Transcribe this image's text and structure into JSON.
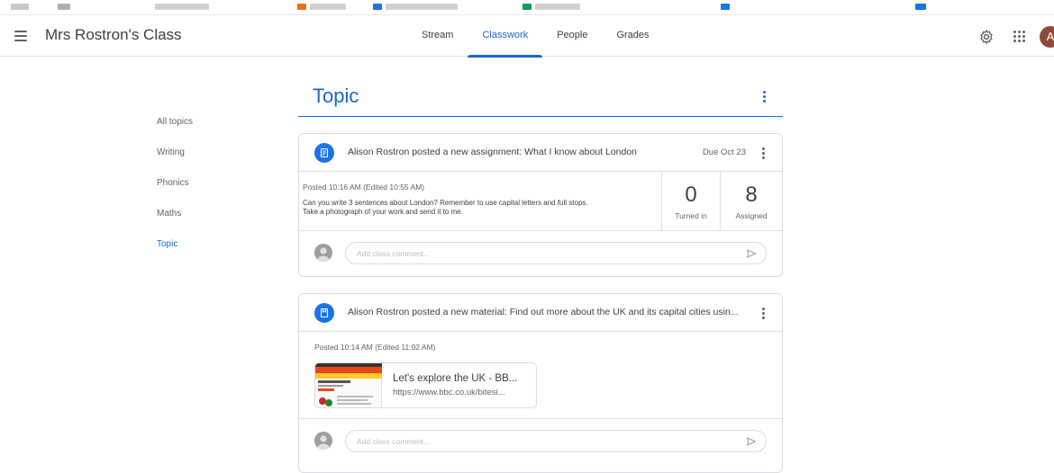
{
  "header": {
    "class_title": "Mrs Rostron's Class",
    "avatar_letter": "A",
    "tabs": [
      {
        "label": "Stream"
      },
      {
        "label": "Classwork"
      },
      {
        "label": "People"
      },
      {
        "label": "Grades"
      }
    ],
    "active_tab": "Classwork"
  },
  "sidebar": {
    "items": [
      {
        "label": "All topics"
      },
      {
        "label": "Writing"
      },
      {
        "label": "Phonics"
      },
      {
        "label": "Maths"
      },
      {
        "label": "Topic"
      }
    ],
    "active": "Topic"
  },
  "topic": {
    "title": "Topic"
  },
  "assignment": {
    "title": "Alison Rostron posted a new assignment: What I know about London",
    "due": "Due Oct 23",
    "posted": "Posted 10:16 AM (Edited 10:55 AM)",
    "description_line1": "Can you write 3 sentences about London? Remember to use capital letters and full stops.",
    "description_line2": "Take a photograph of your work and send it to me.",
    "turned_in_count": "0",
    "turned_in_label": "Turned in",
    "assigned_count": "8",
    "assigned_label": "Assigned",
    "comment_placeholder": "Add class comment..."
  },
  "material": {
    "title": "Alison Rostron posted a new material: Find out more about the UK and its capital cities usin...",
    "posted": "Posted 10:14 AM (Edited 11:02 AM)",
    "attachment_title": "Let's explore the UK - BB...",
    "attachment_url": "https://www.bbc.co.uk/bitesi...",
    "comment_placeholder": "Add class comment..."
  },
  "colors": {
    "accent": "#1967d2",
    "icon_blue": "#1a73e8"
  }
}
